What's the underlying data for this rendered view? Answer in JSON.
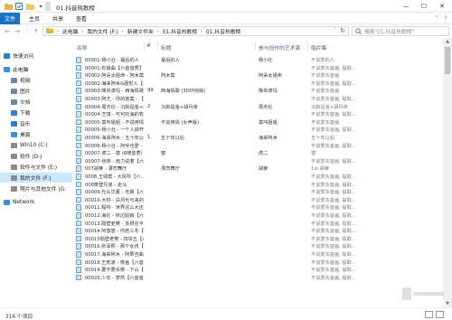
{
  "window": {
    "title": "01.抖音热歌榜"
  },
  "ribbon": {
    "tabs": [
      "文件",
      "主页",
      "共享",
      "查看"
    ]
  },
  "address": {
    "crumbs": [
      "此电脑",
      "我的文件 (F:)",
      "新建文件夹",
      "01.抖音热歌榜",
      "01.抖音热歌榜"
    ],
    "search_placeholder": "搜索\"01.抖音热歌榜\""
  },
  "sidebar": {
    "items": [
      {
        "label": "快速访问",
        "icon": "star-icon",
        "color": "#2f7bd6"
      },
      {
        "label": "此电脑",
        "icon": "computer-icon",
        "color": "#3b8fd8"
      },
      {
        "label": "视频",
        "icon": "video-folder-icon",
        "color": "#6e86a8"
      },
      {
        "label": "图片",
        "icon": "pictures-folder-icon",
        "color": "#6e86a8"
      },
      {
        "label": "文档",
        "icon": "documents-folder-icon",
        "color": "#6e86a8"
      },
      {
        "label": "下载",
        "icon": "downloads-folder-icon",
        "color": "#2f7bd6"
      },
      {
        "label": "音乐",
        "icon": "music-folder-icon",
        "color": "#2f7bd6"
      },
      {
        "label": "桌面",
        "icon": "desktop-folder-icon",
        "color": "#3b8fd8"
      },
      {
        "label": "Win10 (C:)",
        "icon": "drive-icon",
        "color": "#8a8a8a"
      },
      {
        "label": "软件 (D:)",
        "icon": "drive-icon",
        "color": "#8a8a8a"
      },
      {
        "label": "软件与文件 (E:)",
        "icon": "drive-icon",
        "color": "#8a8a8a"
      },
      {
        "label": "我的文件 (F:)",
        "icon": "drive-icon",
        "color": "#8a8a8a"
      },
      {
        "label": "照片与其他文件 (G:",
        "icon": "drive-icon",
        "color": "#8a8a8a"
      },
      {
        "label": "Network",
        "icon": "network-icon",
        "color": "#3b8fd8"
      }
    ],
    "selected_index": 11
  },
  "columns": [
    "名称",
    "#",
    "标题",
    "参与创作的艺术家",
    "唱片集"
  ],
  "files": [
    [
      "00001-杨小壮 - 最后的人",
      "",
      "最后的人",
      "杨小壮",
      "不说爱的人"
    ],
    [
      "00001-你晨曲【六音音质】",
      "",
      "",
      "",
      "不说爱东音画, 提取..."
    ],
    [
      "00002-阿朵太姐命 - 阿木莫",
      "",
      "阿木莫",
      "阿朵太姐命",
      "不说爱东音画"
    ],
    [
      "00002-海来阿木&图形人【六...",
      "",
      "",
      "",
      "不说爱东音画, 提取..."
    ],
    [
      "00003-降央卓玛 - 西海情歌",
      "99",
      "西海情歌 (3D环绕版)",
      "降央卓玛",
      "不说爱东音画"
    ],
    [
      "00003-阿兀 - 你的答案 - 【六...",
      "",
      "",
      "",
      "不说爱东音画, 提取..."
    ],
    [
      "00004-周杰伦 - 沉默是金+胡月...",
      "2",
      "沉默是金+胡月夜",
      "周杰伦",
      "沉默是金+胡月夜"
    ],
    [
      "00004-王琪 - 可可托海的牧羊...",
      "",
      "",
      "",
      "不说爱东音画, 提取..."
    ],
    [
      "00005-莫叫姐姐 - 不说用情 (女...",
      "",
      "不说用情 (女声版)",
      "莫叫姐姐",
      "不说爱东音画"
    ],
    [
      "00005-杨小壮 - 一个人掉杆...",
      "",
      "",
      "",
      "不说爱东音画, 提取..."
    ],
    [
      "00006-海来阿木 - 五十年以后",
      "1",
      "五十年以后",
      "海来阿木",
      "五十年以后"
    ],
    [
      "00006-杨小壮 - 阿爷也爱 - 【...",
      "",
      "",
      "",
      "不说爱东音画, 提取..."
    ],
    [
      "00007-虎二 - 窗 (6嗖音质)",
      "",
      "窗",
      "虎二",
      "窗"
    ],
    [
      "00007-张炜 - 雨力说着【六...",
      "",
      "",
      "",
      "不说爱东音画, 提取..."
    ],
    [
      "007胡莱 - 漂司舞厅",
      "",
      "漂司舞厅",
      "胡莱",
      "1st.胡莱"
    ],
    [
      "0008.王靖帮 - 大风吹【六...",
      "",
      "",
      "",
      "不说爱东音画, 提取..."
    ],
    [
      "008摩登兄弟 - 走马",
      "",
      "",
      "",
      "不说爱东音画, 提取..."
    ],
    [
      "00009.光头华夏 - 无期【六音...",
      "",
      "",
      "",
      "不说爱东音画, 提取..."
    ],
    [
      "00010-大籽 - 白月光与来的梦...",
      "",
      "",
      "",
      "不说爱东音画, 提取..."
    ],
    [
      "00011.程响 - 世界这么大还是遇...",
      "",
      "",
      "",
      "不说爱东音画, 提取..."
    ],
    [
      "00012.海伦 - 桥边姑娘【六音...",
      "",
      "",
      "",
      "不说爱东音画, 提取..."
    ],
    [
      "00013.隔壁老樊 - 多想在平庸的...",
      "",
      "",
      "",
      "不说爱东音画, 提取..."
    ],
    [
      "00014.阿悠悠 - 你若三冬【六...",
      "",
      "",
      "",
      "不说爱东音画, 提取..."
    ],
    [
      "00015隔壁老樊 - 四块五【六...",
      "",
      "",
      "",
      "不说爱东音画, 提取..."
    ],
    [
      "00016.张泽熙 - 那个女孩【六...",
      "",
      "",
      "",
      "不说爱东音画, 提取..."
    ],
    [
      "00017.海来阿木 - 阿果吉曲【...",
      "",
      "",
      "",
      "不说爱东音画, 提取..."
    ],
    [
      "00018.王贰浪 - 像鱼【六音音...",
      "",
      "",
      "",
      "不说爱东音画, 提取..."
    ],
    [
      "00019.要不要买菜 - 下山【六...",
      "",
      "",
      "",
      "不说爱东音画, 提取..."
    ],
    [
      "00020.少年 - 梦然【六音音...",
      "",
      "",
      "",
      "不说爱东音画, 提取..."
    ]
  ],
  "status": {
    "count": "316 个项目"
  }
}
